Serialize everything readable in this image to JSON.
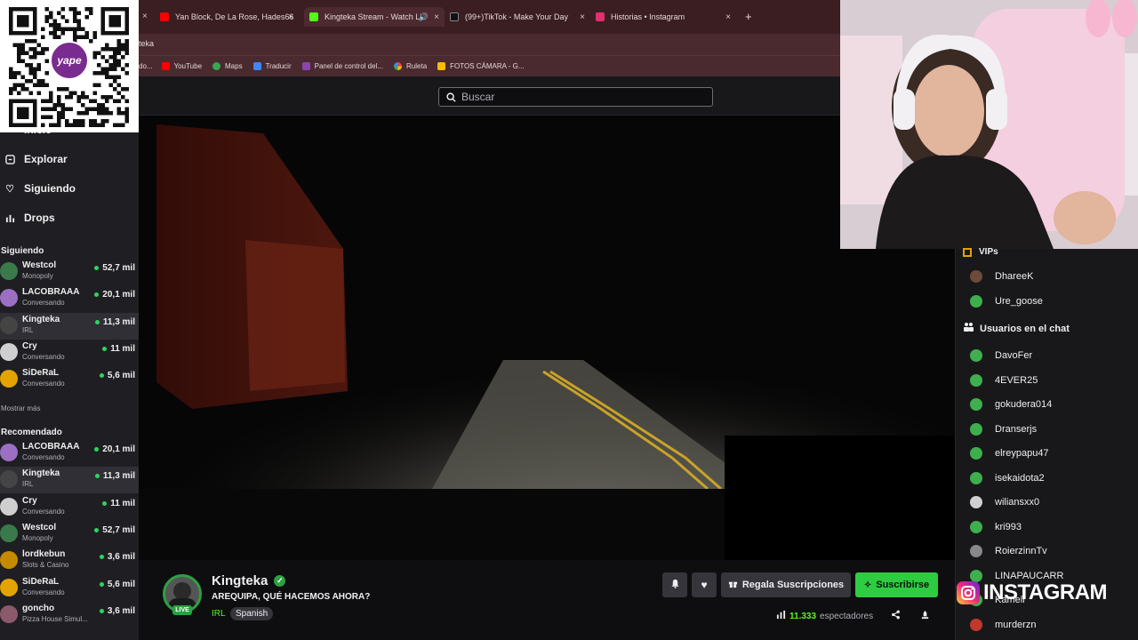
{
  "browser": {
    "tabs": [
      {
        "label": "Yan Block, De La Rose, Hades66",
        "color": "#ff0000"
      },
      {
        "label": "Kingteka Stream - Watch Li",
        "color": "#53fc18"
      },
      {
        "label": "(99+)TikTok - Make Your Day",
        "color": "#111111"
      },
      {
        "label": "Historias • Instagram",
        "color": "#e1306c"
      }
    ],
    "new_tab": "+",
    "address": "teka",
    "bookmarks": [
      {
        "label": "YouTube",
        "color": "#ff0000"
      },
      {
        "label": "Maps",
        "color": "#34a853"
      },
      {
        "label": "Traducir",
        "color": "#4285f4"
      },
      {
        "label": "Panel de control del...",
        "color": "#8e44ad"
      },
      {
        "label": "Ruleta",
        "color": "#f4b400"
      },
      {
        "label": "FOTOS CÁMARA - G...",
        "color": "#fbbc05"
      }
    ],
    "bookmark_cut": "do..."
  },
  "search": {
    "placeholder": "Buscar"
  },
  "sidebar": {
    "nav": [
      {
        "label": "Inicio",
        "icon": "home-icon"
      },
      {
        "label": "Explorar",
        "icon": "compass-icon"
      },
      {
        "label": "Siguiendo",
        "icon": "heart-icon"
      },
      {
        "label": "Drops",
        "icon": "gift-icon"
      }
    ],
    "following_title": "Siguiendo",
    "following": [
      {
        "name": "Westcol",
        "category": "Monopoly",
        "viewers": "52,7 mil",
        "color": "#3a7a4a"
      },
      {
        "name": "LACOBRAAA",
        "category": "Conversando",
        "viewers": "20,1 mil",
        "color": "#9b6fc1"
      },
      {
        "name": "Kingteka",
        "category": "IRL",
        "viewers": "11,3 mil",
        "color": "#444444"
      },
      {
        "name": "Cry",
        "category": "Conversando",
        "viewers": "11 mil",
        "color": "#cfcfcf"
      },
      {
        "name": "SiDeRaL",
        "category": "Conversando",
        "viewers": "5,6 mil",
        "color": "#e3a300"
      }
    ],
    "show_more": "Mostrar más",
    "recommended_title": "Recomendado",
    "recommended": [
      {
        "name": "LACOBRAAA",
        "category": "Conversando",
        "viewers": "20,1 mil",
        "color": "#9b6fc1"
      },
      {
        "name": "Kingteka",
        "category": "IRL",
        "viewers": "11,3 mil",
        "color": "#444444"
      },
      {
        "name": "Cry",
        "category": "Conversando",
        "viewers": "11 mil",
        "color": "#cfcfcf"
      },
      {
        "name": "Westcol",
        "category": "Monopoly",
        "viewers": "52,7 mil",
        "color": "#3a7a4a"
      },
      {
        "name": "lordkebun",
        "category": "Slots & Casino",
        "viewers": "3,6 mil",
        "color": "#c58b00"
      },
      {
        "name": "SiDeRaL",
        "category": "Conversando",
        "viewers": "5,6 mil",
        "color": "#e3a300"
      },
      {
        "name": "goncho",
        "category": "Pizza House Simul...",
        "viewers": "3,6 mil",
        "color": "#8a5a6a"
      }
    ]
  },
  "qr": {
    "logo_text": "yape"
  },
  "channel": {
    "name": "Kingteka",
    "live": "LIVE",
    "title": "AREQUIPA, QUÉ HACEMOS AHORA?",
    "category": "IRL",
    "tag": "Spanish",
    "gift_label": "Regala Suscripciones",
    "subscribe_label": "Suscribirse",
    "viewers_count": "11.333",
    "viewers_label": "espectadores"
  },
  "chat_users": {
    "vip_title": "VIPs",
    "vips": [
      {
        "name": "DhareeK",
        "color": "#6b4b3b"
      },
      {
        "name": "Ure_goose",
        "color": "#3fae4e"
      }
    ],
    "users_title": "Usuarios en el chat",
    "users": [
      {
        "name": "DavoFer",
        "color": "#3fae4e"
      },
      {
        "name": "4EVER25",
        "color": "#3fae4e"
      },
      {
        "name": "gokudera014",
        "color": "#3fae4e"
      },
      {
        "name": "Dranserjs",
        "color": "#3fae4e"
      },
      {
        "name": "elreypapu47",
        "color": "#3fae4e"
      },
      {
        "name": "isekaidota2",
        "color": "#3fae4e"
      },
      {
        "name": "wiliansxx0",
        "color": "#d0d0d0"
      },
      {
        "name": "kri993",
        "color": "#3fae4e"
      },
      {
        "name": "RoierzinnTv",
        "color": "#888888"
      },
      {
        "name": "LINAPAUCARR",
        "color": "#3fae4e"
      },
      {
        "name": "Kamell",
        "color": "#3fae4e"
      },
      {
        "name": "murderzn",
        "color": "#c0392b"
      }
    ]
  },
  "overlay": {
    "instagram": "INSTAGRAM"
  }
}
